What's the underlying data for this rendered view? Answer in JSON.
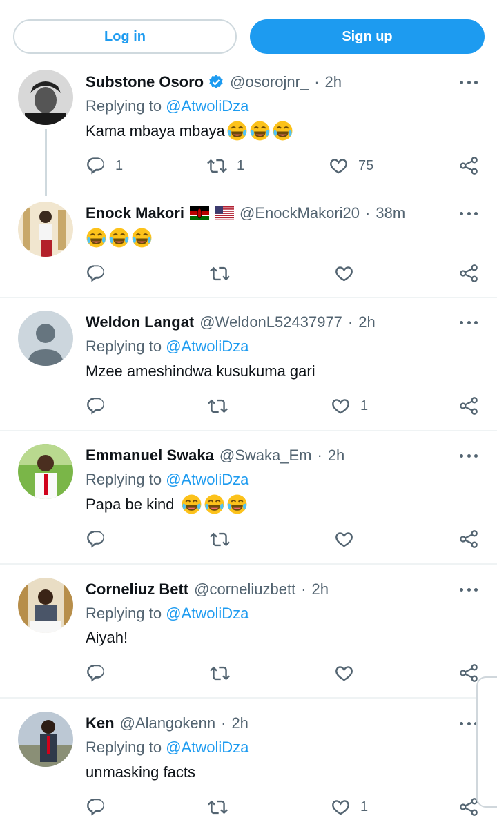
{
  "auth": {
    "login_label": "Log in",
    "signup_label": "Sign up"
  },
  "colors": {
    "accent": "#1d9bf0",
    "secondary_text": "#536471",
    "divider": "#eff3f4"
  },
  "icons": {
    "reply": "speech-bubble-icon",
    "retweet": "retweet-icon",
    "like": "heart-icon",
    "share": "share-icon",
    "more": "more-options-icon",
    "verified": "verified-badge-icon"
  },
  "tweets": [
    {
      "name": "Substone Osoro",
      "handle": "@osorojnr_",
      "time": "2h",
      "replying_prefix": "Replying to",
      "replying_to": "@AtwoliDza",
      "text": "Kama mbaya mbaya",
      "emoji_count": 3,
      "replies": "1",
      "retweets": "1",
      "likes": "75"
    },
    {
      "name": "Enock Makori",
      "handle": "@EnockMakori20",
      "time": "38m",
      "replying_prefix": "",
      "replying_to": "",
      "text": "",
      "emoji_count": 3,
      "replies": "",
      "retweets": "",
      "likes": ""
    },
    {
      "name": "Weldon Langat",
      "handle": "@WeldonL52437977",
      "time": "2h",
      "replying_prefix": "Replying to",
      "replying_to": "@AtwoliDza",
      "text": "Mzee ameshindwa kusukuma gari",
      "emoji_count": 0,
      "replies": "",
      "retweets": "",
      "likes": "1"
    },
    {
      "name": "Emmanuel Swaka",
      "handle": "@Swaka_Em",
      "time": "2h",
      "replying_prefix": "Replying to",
      "replying_to": "@AtwoliDza",
      "text": "Papa be kind",
      "emoji_count": 3,
      "replies": "",
      "retweets": "",
      "likes": ""
    },
    {
      "name": "Corneliuz Bett",
      "handle": "@corneliuzbett",
      "time": "2h",
      "replying_prefix": "Replying to",
      "replying_to": "@AtwoliDza",
      "text": "Aiyah!",
      "emoji_count": 0,
      "replies": "",
      "retweets": "",
      "likes": ""
    },
    {
      "name": "Ken",
      "handle": "@Alangokenn",
      "time": "2h",
      "replying_prefix": "Replying to",
      "replying_to": "@AtwoliDza",
      "text": "unmasking facts",
      "emoji_count": 0,
      "replies": "",
      "retweets": "",
      "likes": "1"
    }
  ]
}
